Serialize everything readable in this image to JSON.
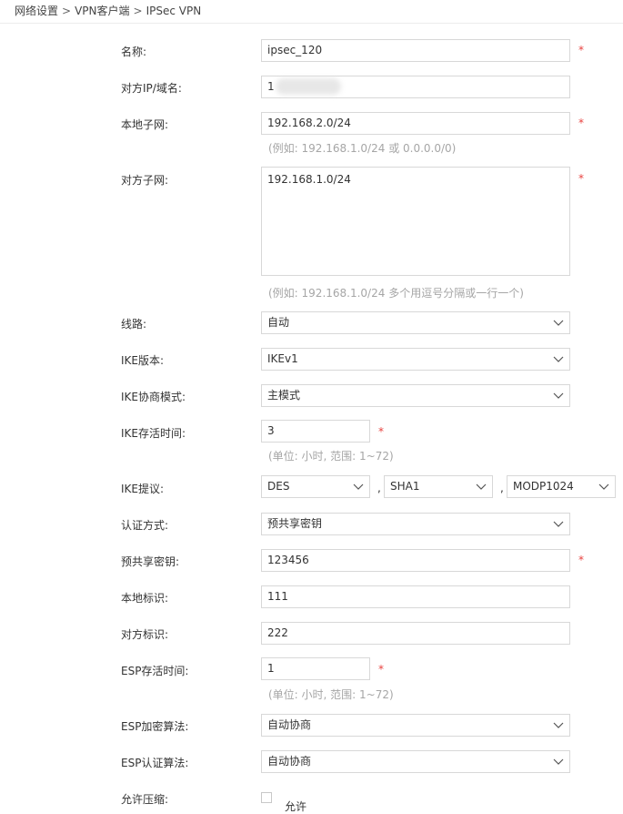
{
  "breadcrumb": {
    "items": [
      "网络设置",
      "VPN客户端",
      "IPSec VPN"
    ],
    "separator": ">"
  },
  "form": {
    "name": {
      "label": "名称:",
      "value": "ipsec_120",
      "required": "*"
    },
    "peer_ip": {
      "label": "对方IP/域名:",
      "value": "1"
    },
    "local_subnet": {
      "label": "本地子网:",
      "value": "192.168.2.0/24",
      "required": "*",
      "hint": "(例如: 192.168.1.0/24 或 0.0.0.0/0)"
    },
    "peer_subnet": {
      "label": "对方子网:",
      "value": "192.168.1.0/24",
      "required": "*",
      "hint": "(例如: 192.168.1.0/24 多个用逗号分隔或一行一个)"
    },
    "line": {
      "label": "线路:",
      "value": "自动"
    },
    "ike_version": {
      "label": "IKE版本:",
      "value": "IKEv1"
    },
    "ike_mode": {
      "label": "IKE协商模式:",
      "value": "主模式"
    },
    "ike_lifetime": {
      "label": "IKE存活时间:",
      "value": "3",
      "required": "*",
      "hint": "(单位: 小时, 范围: 1~72)"
    },
    "ike_proposal": {
      "label": "IKE提议:",
      "encryption": "DES",
      "hash": "SHA1",
      "dh_group": "MODP1024",
      "separator": ","
    },
    "auth_method": {
      "label": "认证方式:",
      "value": "预共享密钥"
    },
    "psk": {
      "label": "预共享密钥:",
      "value": "123456",
      "required": "*"
    },
    "local_id": {
      "label": "本地标识:",
      "value": "111"
    },
    "peer_id": {
      "label": "对方标识:",
      "value": "222"
    },
    "esp_lifetime": {
      "label": "ESP存活时间:",
      "value": "1",
      "required": "*",
      "hint": "(单位: 小时, 范围: 1~72)"
    },
    "esp_encryption": {
      "label": "ESP加密算法:",
      "value": "自动协商"
    },
    "esp_auth": {
      "label": "ESP认证算法:",
      "value": "自动协商"
    },
    "compression": {
      "label": "允许压缩:",
      "option_label": "允许",
      "checked": false
    }
  },
  "colors": {
    "required": "#e8423f",
    "hint": "#a6a6a6",
    "border": "#d8d8d8"
  }
}
